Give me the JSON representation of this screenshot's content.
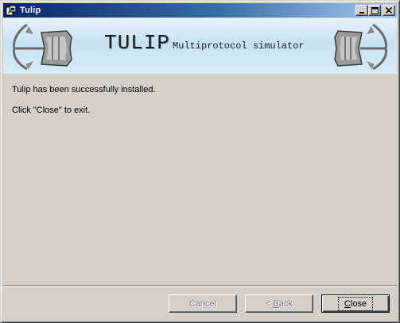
{
  "window": {
    "title": "Tulip",
    "icon": "installer-icon",
    "controls": [
      "minimize",
      "maximize",
      "close"
    ]
  },
  "banner": {
    "title": "TULIP",
    "subtitle": "Multiprotocol simulator",
    "logo_left": "tulip-anchor-logo-left",
    "logo_right": "tulip-anchor-logo-right"
  },
  "content": {
    "line1": "Tulip has been successfully installed.",
    "line2": "Click \"Close\" to exit."
  },
  "buttons": {
    "cancel": "Cancel",
    "back_prefix": "< ",
    "back_accel": "B",
    "back_rest": "ack",
    "close_accel": "C",
    "close_rest": "lose"
  },
  "colors": {
    "face": "#d4d0c8",
    "titlebar_start": "#0a246a",
    "titlebar_end": "#a6caf0",
    "banner": "#c6e2f3"
  }
}
